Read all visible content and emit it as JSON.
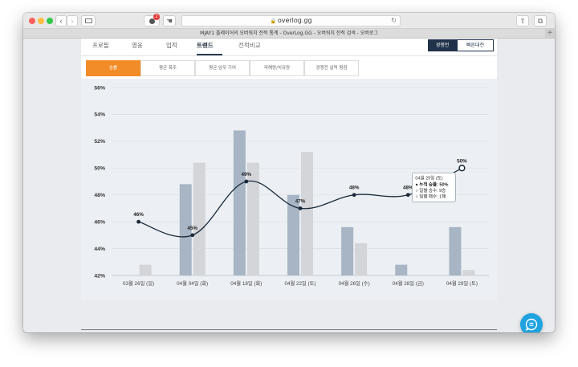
{
  "browser": {
    "url": "overlog.gg",
    "tab_title": "MJAY1 플레이어의 오버워치 전적 통계 - OverLog.GG - 오버워치 전적 검색 - 오버로그",
    "badge_count": "2",
    "new_tab": "+"
  },
  "nav": {
    "items": [
      {
        "label": "프로필"
      },
      {
        "label": "영웅"
      },
      {
        "label": "업적"
      },
      {
        "label": "트렌드"
      },
      {
        "label": "전적비교"
      }
    ],
    "btn_competitive": "경쟁전",
    "btn_quickplay": "빠른대전"
  },
  "subtabs": [
    {
      "label": "승률"
    },
    {
      "label": "평균 폭주"
    },
    {
      "label": "평균 임무 기여"
    },
    {
      "label": "피해량/치유량"
    },
    {
      "label": "경쟁전 실력 평점"
    }
  ],
  "chart_data": {
    "type": "line+bar",
    "y_ticks": [
      "56%",
      "54%",
      "52%",
      "50%",
      "48%",
      "46%",
      "44%",
      "42%"
    ],
    "ylim": [
      42,
      56
    ],
    "categories": [
      "03월 26일 (일)",
      "04월 04일 (화)",
      "04월 18일 (화)",
      "04월 22일 (토)",
      "04월 26일 (수)",
      "04월 28일 (금)",
      "04월 29일 (토)"
    ],
    "line": {
      "values": [
        46,
        45,
        49,
        47,
        48,
        48,
        50
      ],
      "labels": [
        "46%",
        "45%",
        "49%",
        "47%",
        "48%",
        "48%",
        "50%"
      ]
    },
    "bars_dark": [
      null,
      48.8,
      52.8,
      48.0,
      45.6,
      42.8,
      45.6
    ],
    "bars_light": [
      42.8,
      50.4,
      50.4,
      51.2,
      44.4,
      null,
      42.4
    ],
    "tooltip": {
      "title": "04월 29일 (토)",
      "lines": [
        "● 누적 승률: 50%",
        "○ 일별 승수: 9승",
        "○ 일별 패수: 1패"
      ]
    },
    "colors": {
      "line": "#1a2a3a",
      "bar_dark": "#a7b5c4",
      "bar_light": "#d3d5d8",
      "accent": "#f28c28"
    }
  }
}
